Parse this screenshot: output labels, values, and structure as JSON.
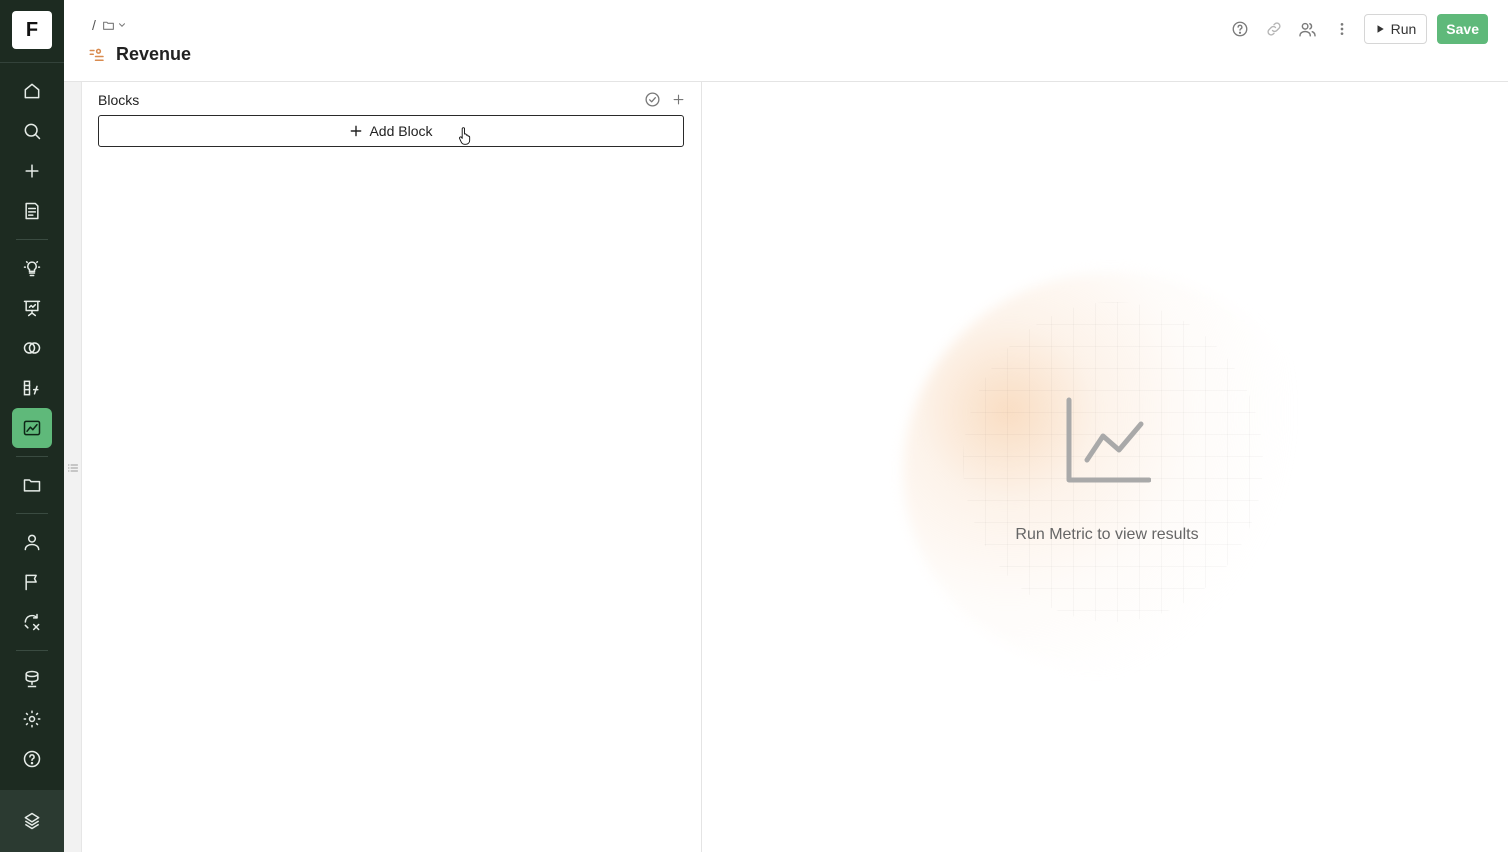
{
  "app": {
    "logo_letter": "F"
  },
  "sidebar": {
    "items": [
      {
        "icon": "home-icon"
      },
      {
        "icon": "search-icon"
      },
      {
        "icon": "plus-icon"
      },
      {
        "icon": "notebook-icon"
      },
      {
        "icon": "lightbulb-icon"
      },
      {
        "icon": "presentation-icon"
      },
      {
        "icon": "segments-icon"
      },
      {
        "icon": "formula-icon"
      },
      {
        "icon": "metric-chart-icon",
        "active": true
      },
      {
        "icon": "folder-icon"
      },
      {
        "icon": "user-icon"
      },
      {
        "icon": "flag-icon"
      },
      {
        "icon": "experiment-icon"
      },
      {
        "icon": "database-icon"
      },
      {
        "icon": "settings-icon"
      },
      {
        "icon": "help-icon"
      }
    ],
    "bottom_icon": "stack-logo-icon",
    "accent_color": "#5fb97a",
    "background_color": "#1d2b21"
  },
  "header": {
    "breadcrumb_separator": "/",
    "title": "Revenue",
    "run_label": "Run",
    "save_label": "Save"
  },
  "blocks": {
    "title": "Blocks",
    "add_block_label": "Add Block"
  },
  "results": {
    "empty_message": "Run Metric to view results"
  }
}
